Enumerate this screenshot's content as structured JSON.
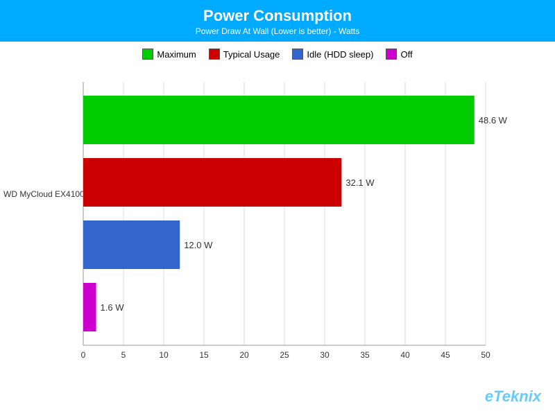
{
  "header": {
    "title": "Power Consumption",
    "subtitle": "Power Draw At Wall (Lower is better) - Watts"
  },
  "legend": {
    "items": [
      {
        "label": "Maximum",
        "color": "#00cc00"
      },
      {
        "label": "Typical Usage",
        "color": "#cc0000"
      },
      {
        "label": "Idle (HDD sleep)",
        "color": "#3366cc"
      },
      {
        "label": "Off",
        "color": "#cc00cc"
      }
    ]
  },
  "chart": {
    "device_label": "WD MyCloud EX4100",
    "bars": [
      {
        "label": "Maximum",
        "value": 48.6,
        "color": "#00cc00"
      },
      {
        "label": "Typical Usage",
        "value": 32.1,
        "color": "#cc0000"
      },
      {
        "label": "Idle (HDD sleep)",
        "value": 12.0,
        "color": "#3366cc"
      },
      {
        "label": "Off",
        "value": 1.6,
        "color": "#cc00cc"
      }
    ],
    "x_max": 50,
    "x_ticks": [
      0,
      5,
      10,
      15,
      20,
      25,
      30,
      35,
      40,
      45,
      50
    ],
    "value_labels": [
      "48.6 W",
      "32.1 W",
      "12.0 W",
      "1.6 W"
    ]
  },
  "watermark": "eTeknix"
}
